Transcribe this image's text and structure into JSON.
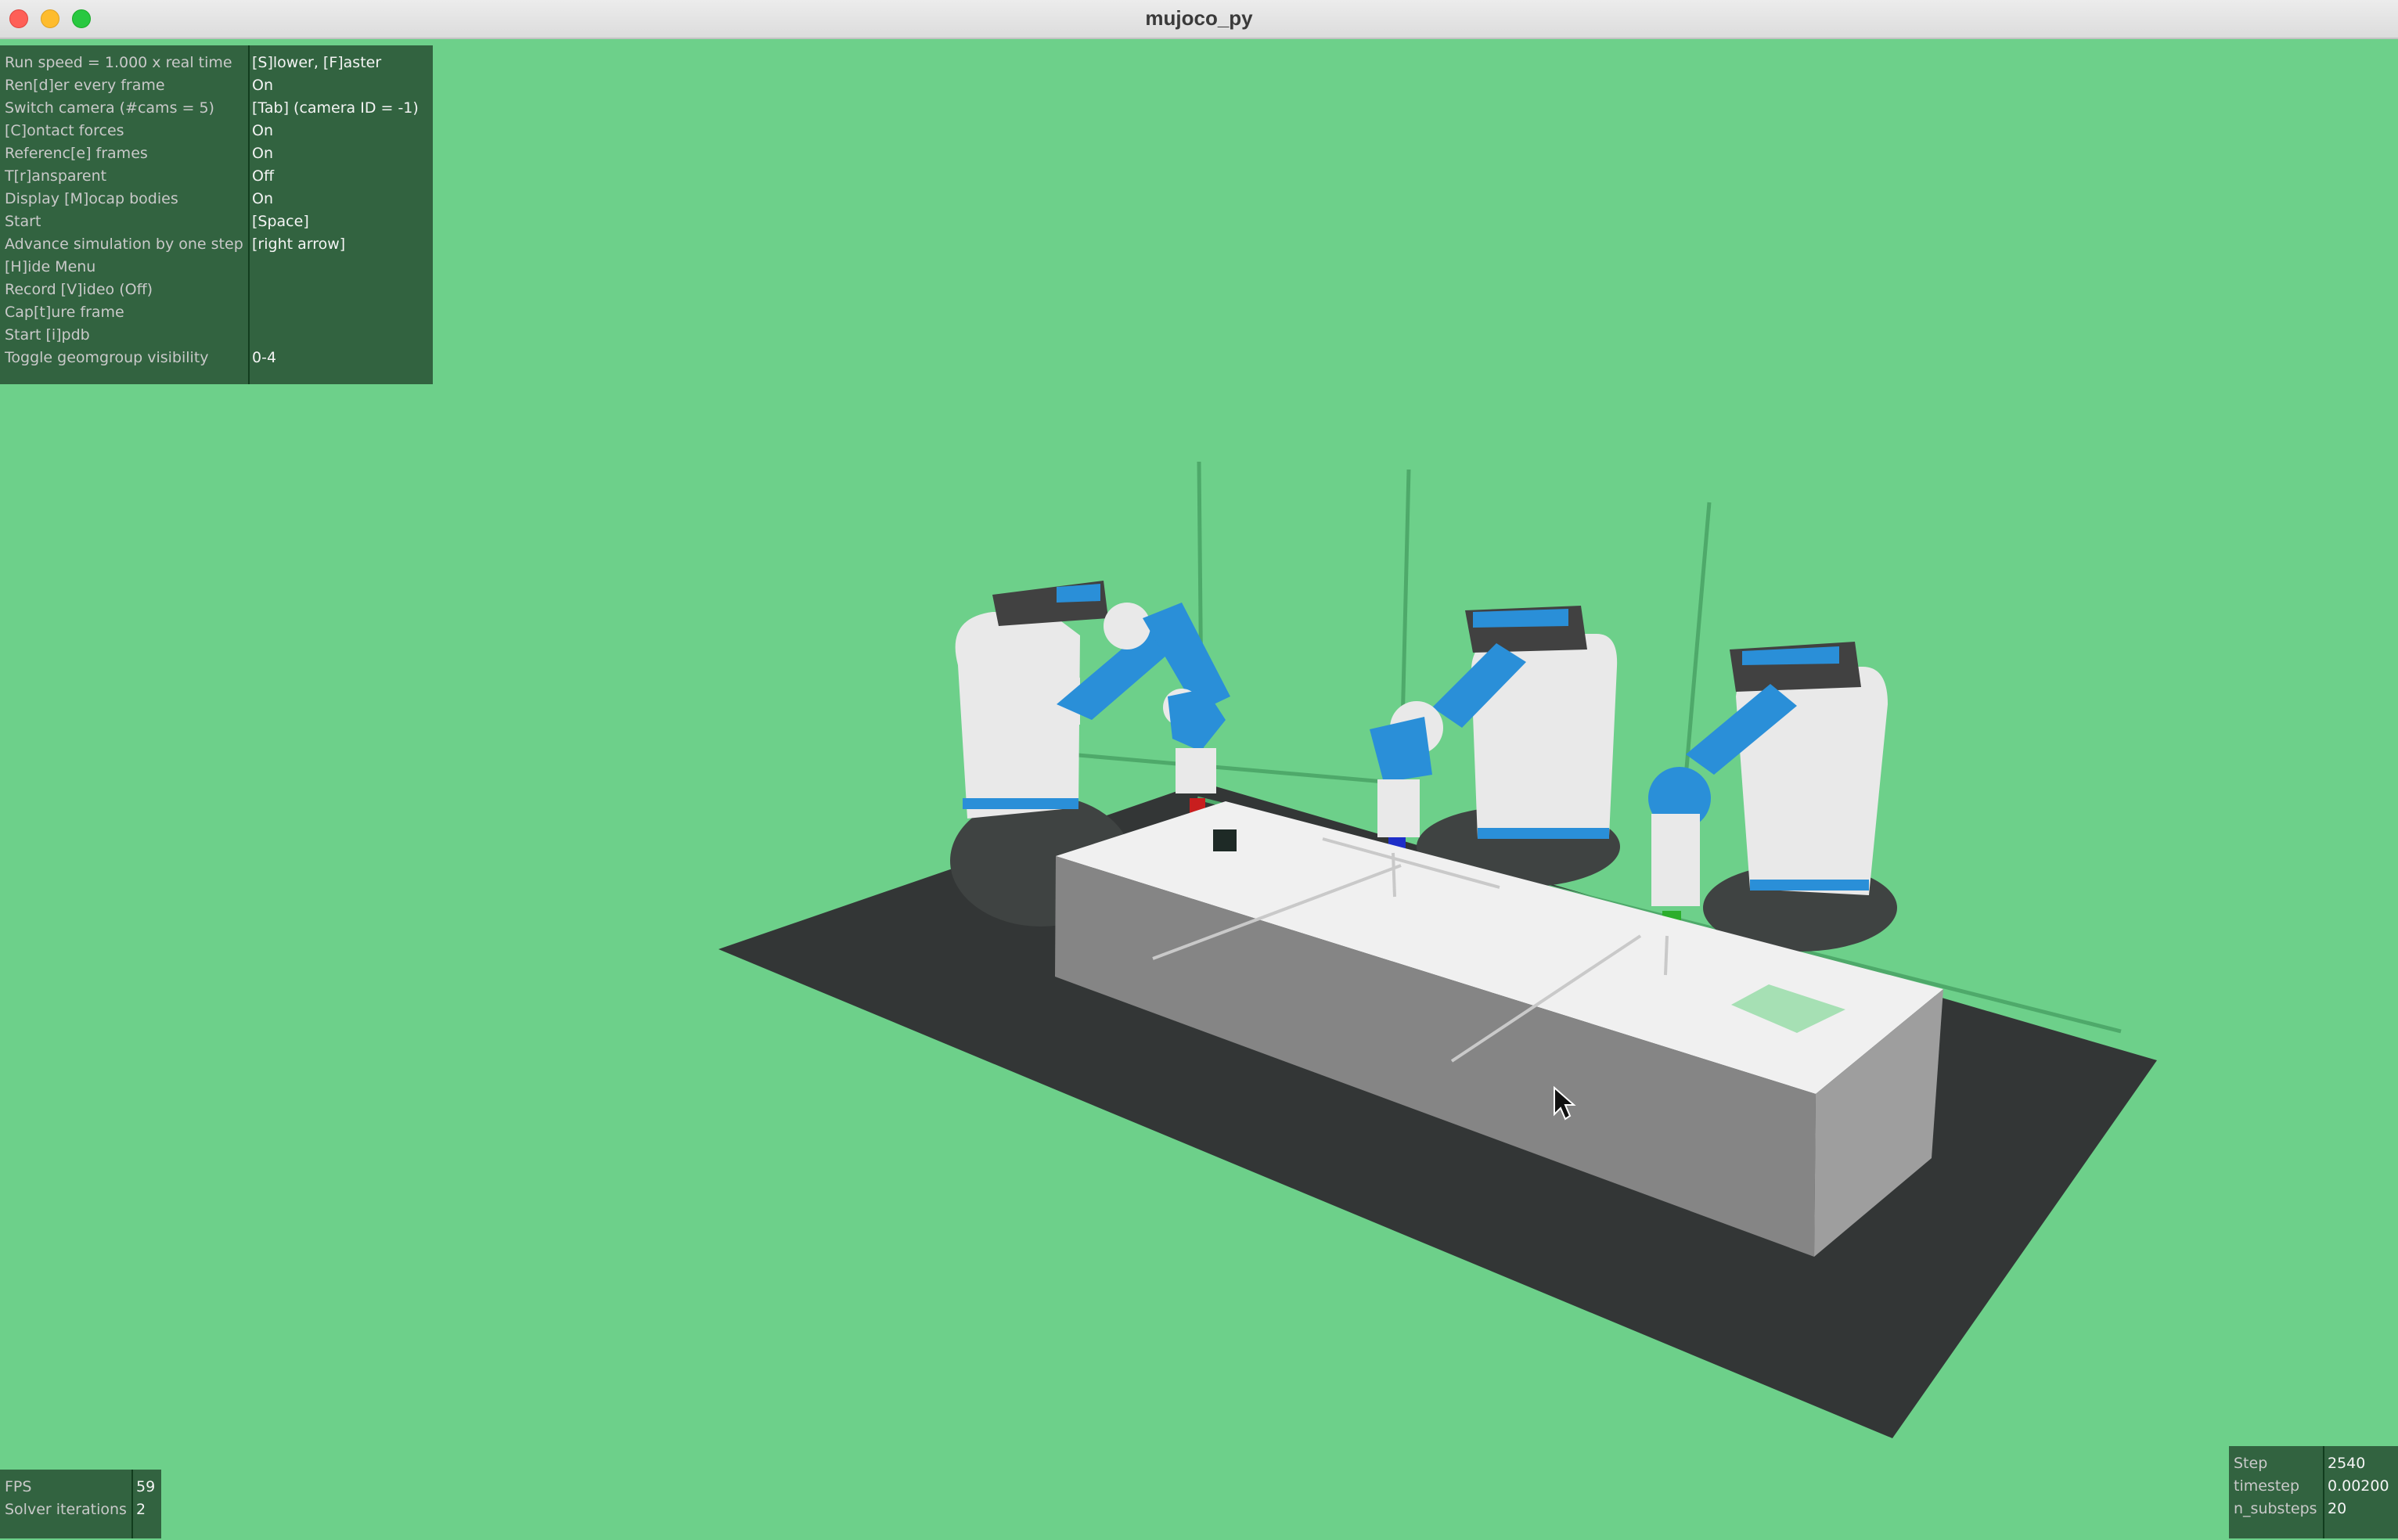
{
  "window": {
    "title": "mujoco_py"
  },
  "menu": {
    "rows": [
      {
        "label": "Run speed = 1.000 x real time",
        "value": "[S]lower, [F]aster"
      },
      {
        "label": "Ren[d]er every frame",
        "value": "On"
      },
      {
        "label": "Switch camera (#cams = 5)",
        "value": "[Tab] (camera ID = -1)"
      },
      {
        "label": "[C]ontact forces",
        "value": "On"
      },
      {
        "label": "Referenc[e] frames",
        "value": "On"
      },
      {
        "label": "T[r]ansparent",
        "value": "Off"
      },
      {
        "label": "Display [M]ocap bodies",
        "value": "On"
      },
      {
        "label": "Start",
        "value": "[Space]"
      },
      {
        "label": "Advance simulation by one step",
        "value": "[right arrow]"
      },
      {
        "label": "[H]ide Menu",
        "value": ""
      },
      {
        "label": "Record [V]ideo (Off)",
        "value": ""
      },
      {
        "label": "Cap[t]ure frame",
        "value": ""
      },
      {
        "label": "Start [i]pdb",
        "value": ""
      },
      {
        "label": "Toggle geomgroup visibility",
        "value": "0-4"
      }
    ]
  },
  "stats_left": {
    "rows": [
      {
        "label": "FPS",
        "value": "59"
      },
      {
        "label": "Solver iterations",
        "value": "2"
      }
    ]
  },
  "stats_right": {
    "rows": [
      {
        "label": "Step",
        "value": "2540"
      },
      {
        "label": "timestep",
        "value": "0.00200"
      },
      {
        "label": "n_substeps",
        "value": "20"
      }
    ]
  },
  "scene": {
    "background_color": "#6dd08a",
    "floor_color": "#333636",
    "table_color": "#f0f0f0",
    "robot_color": "#e9e9e9",
    "arm_color": "#2a8fd8",
    "marker_colors": [
      "#c81e1e",
      "#1e2ec8",
      "#2cae2c"
    ],
    "target_color": "#a6e0b4",
    "object_color": "#1e2a26"
  }
}
